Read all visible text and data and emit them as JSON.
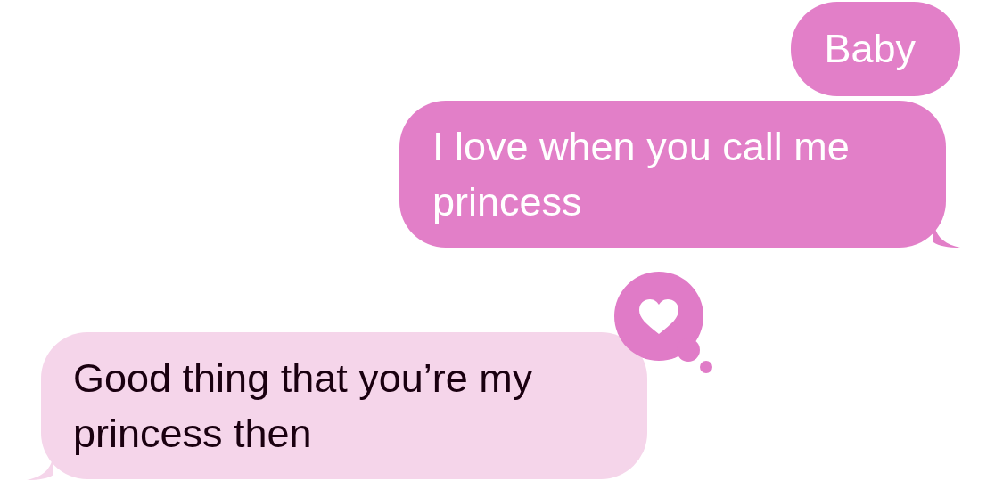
{
  "messages": [
    {
      "kind": "sent",
      "text": "Baby",
      "tail": false
    },
    {
      "kind": "sent",
      "text": "I love when you call me princess",
      "tail": true
    },
    {
      "kind": "received",
      "text": "Good thing that you’re my princess then",
      "tail": true,
      "heart_reaction": true
    }
  ]
}
